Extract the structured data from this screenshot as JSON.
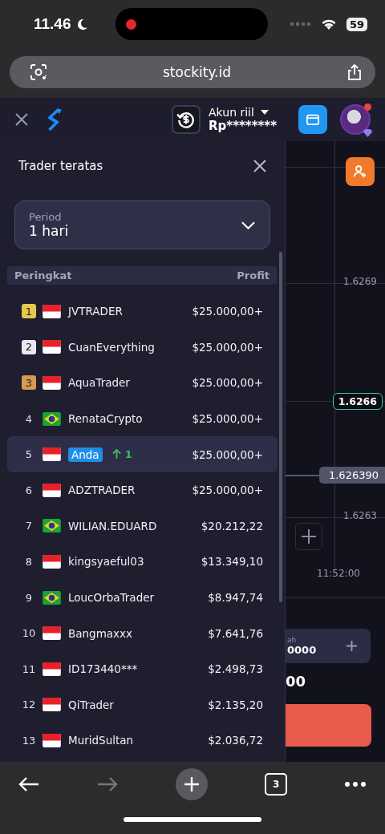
{
  "status_bar": {
    "time": "11.46",
    "battery": "59"
  },
  "browser": {
    "url": "stockity.id",
    "tab_count": "3"
  },
  "app_header": {
    "account_label": "Akun riil",
    "balance": "Rp********"
  },
  "panel": {
    "title": "Trader teratas",
    "period": {
      "label": "Period",
      "value": "1 hari"
    },
    "columns": [
      "Peringkat",
      "Profit"
    ],
    "rows": [
      {
        "rank": "1",
        "color": "#e6c84a",
        "kind": "indonesia",
        "name": "JVTRADER",
        "profit": "$25.000,00+",
        "selected": false
      },
      {
        "rank": "2",
        "color": "#e8e8ee",
        "kind": "indonesia",
        "name": "CuanEverything",
        "profit": "$25.000,00+",
        "selected": false
      },
      {
        "rank": "3",
        "color": "#d69a52",
        "kind": "indonesia",
        "name": "AquaTrader",
        "profit": "$25.000,00+",
        "selected": false
      },
      {
        "rank": "4",
        "kind": "brazil",
        "name": "RenataCrypto",
        "profit": "$25.000,00+",
        "selected": false
      },
      {
        "rank": "5",
        "kind": "indonesia",
        "name": "Anda",
        "change": "1",
        "profit": "$25.000,00+",
        "selected": true
      },
      {
        "rank": "6",
        "kind": "indonesia",
        "name": "ADZTRADER",
        "profit": "$25.000,00+",
        "selected": false
      },
      {
        "rank": "7",
        "kind": "brazil",
        "name": "WILIAN.EDUARD",
        "profit": "$20.212,22",
        "selected": false
      },
      {
        "rank": "8",
        "kind": "indonesia",
        "name": "kingsyaeful03",
        "profit": "$13.349,10",
        "selected": false
      },
      {
        "rank": "9",
        "kind": "brazil",
        "name": "LoucOrbaTrader",
        "profit": "$8.947,74",
        "selected": false
      },
      {
        "rank": "10",
        "kind": "indonesia",
        "name": "Bangmaxxx",
        "profit": "$7.641,76",
        "selected": false
      },
      {
        "rank": "11",
        "kind": "indonesia",
        "name": "ID173440***",
        "profit": "$2.498,73",
        "selected": false
      },
      {
        "rank": "12",
        "kind": "indonesia",
        "name": "QiTrader",
        "profit": "$2.135,20",
        "selected": false
      },
      {
        "rank": "13",
        "kind": "indonesia",
        "name": "MuridSultan",
        "profit": "$2.036,72",
        "selected": false
      }
    ]
  },
  "chart": {
    "price_labels": [
      "1.6269",
      "1.6263"
    ],
    "current_badge": "1.6266",
    "price_line": "1.626390",
    "time_label": "11:52:00",
    "amount_label": "ah",
    "amount_value": "0000",
    "payout": "00"
  }
}
